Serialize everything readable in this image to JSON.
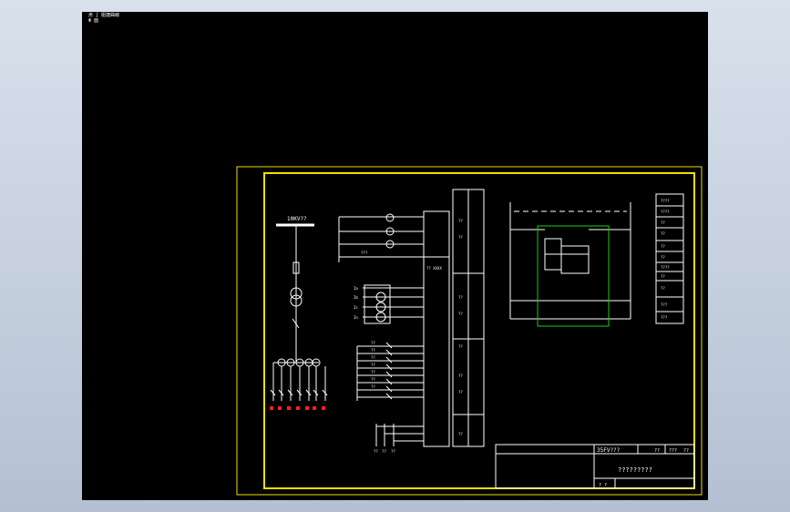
{
  "viewport": {
    "readout_line1": "卅 ∫ 姐捷曲線",
    "readout_line2": "Φ 面"
  },
  "schematic": {
    "busbar_label": "10KV??",
    "relay_panel_label": "?? XXXX",
    "left_terminal_labels": [
      "??",
      "??",
      "??",
      "??",
      "??",
      "??",
      "??",
      "??"
    ],
    "protection_labels": [
      "??",
      "??",
      "??",
      "??",
      "??",
      "??",
      "??"
    ],
    "meter_labels": [
      "Ia",
      "Ib",
      "Ic",
      "In"
    ],
    "bottom_labels": [
      "??",
      "??",
      "??"
    ],
    "supply_label": "???"
  },
  "legend_table": {
    "rows": [
      "????",
      "????",
      "??",
      "??",
      "??",
      "??",
      "????",
      "??",
      "??",
      "???",
      "???"
    ]
  },
  "title_block": {
    "drawing_code": "35FV???",
    "field_a": "??",
    "field_b": "???",
    "field_c": "??",
    "title": "?????????",
    "sheet": "? ?"
  },
  "colors": {
    "frame": "#f0e000",
    "line": "#ffffff",
    "accent": "#18d018",
    "alert": "#ff2020",
    "viewport_bg": "#000000"
  }
}
